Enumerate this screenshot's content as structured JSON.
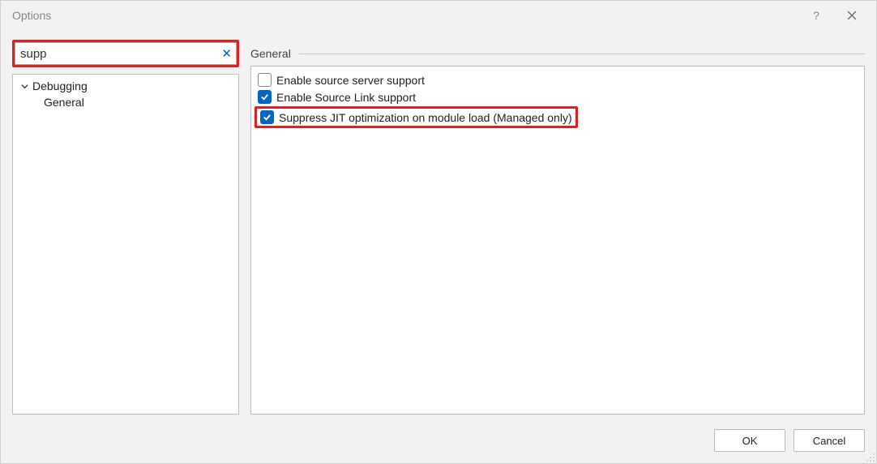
{
  "dialog": {
    "title": "Options",
    "help_tooltip": "?",
    "close_icon": "close"
  },
  "search": {
    "value": "supp",
    "clear_label": "✕"
  },
  "tree": {
    "items": [
      {
        "label": "Debugging",
        "expanded": true
      },
      {
        "label": "General",
        "child": true
      }
    ]
  },
  "panel": {
    "group_title": "General",
    "options": [
      {
        "label": "Enable source server support",
        "checked": false,
        "highlighted": false
      },
      {
        "label": "Enable Source Link support",
        "checked": true,
        "highlighted": false
      },
      {
        "label": "Suppress JIT optimization on module load (Managed only)",
        "checked": true,
        "highlighted": true
      }
    ]
  },
  "buttons": {
    "ok": "OK",
    "cancel": "Cancel"
  }
}
